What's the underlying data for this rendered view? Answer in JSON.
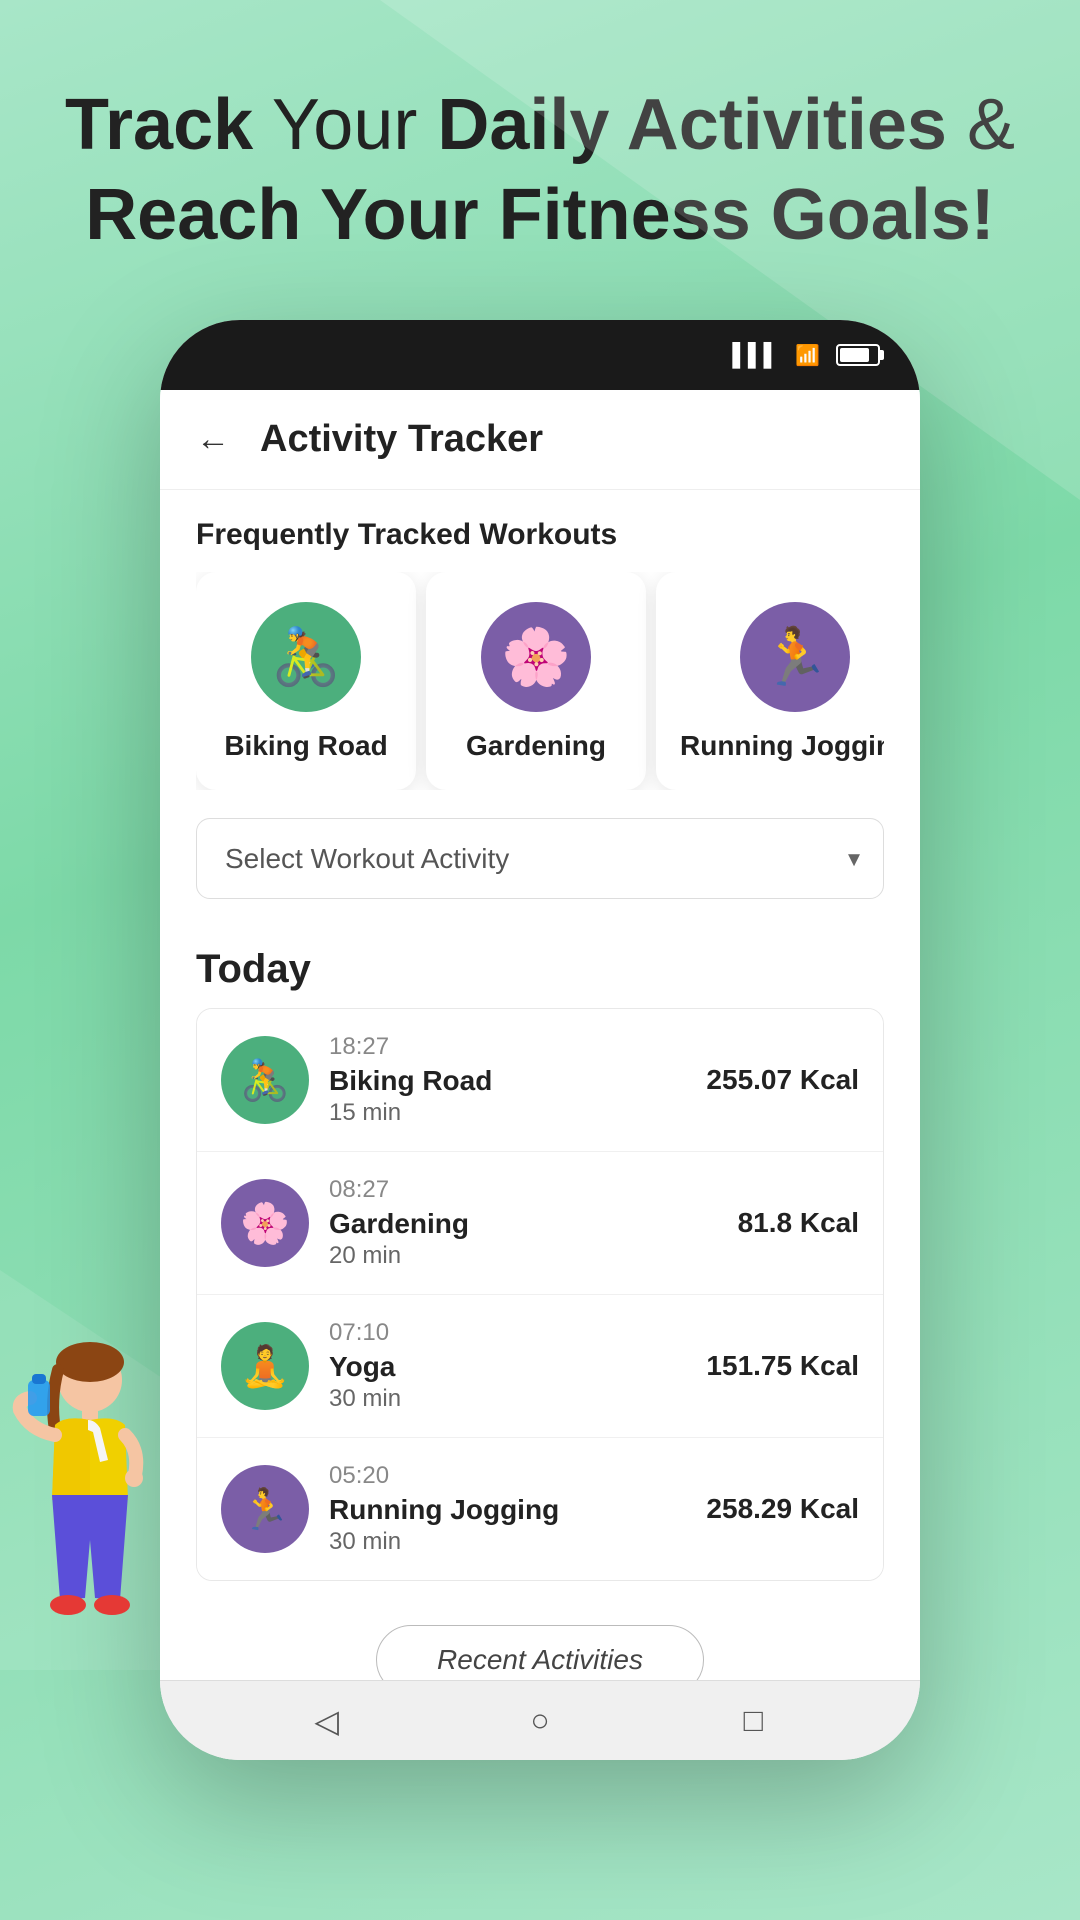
{
  "hero": {
    "line1_normal": "Track Your ",
    "line1_bold": "Daily Activities",
    "line1_normal2": " &",
    "line2": "Reach Your Fitness Goals!"
  },
  "app": {
    "title": "Activity Tracker",
    "back_label": "←"
  },
  "frequently_tracked": {
    "label": "Frequently Tracked Workouts",
    "cards": [
      {
        "name": "Biking Road",
        "icon": "🚴",
        "bg": "green"
      },
      {
        "name": "Gardening",
        "icon": "🌸",
        "bg": "purple"
      },
      {
        "name": "Running Jogging",
        "icon": "🏃",
        "bg": "purple"
      }
    ]
  },
  "dropdown": {
    "placeholder": "Select Workout Activity"
  },
  "today": {
    "label": "Today",
    "activities": [
      {
        "time": "18:27",
        "name": "Biking Road",
        "duration": "15 min",
        "kcal": "255.07 Kcal",
        "icon": "🚴",
        "bg": "green"
      },
      {
        "time": "08:27",
        "name": "Gardening",
        "duration": "20 min",
        "kcal": "81.8 Kcal",
        "icon": "🌸",
        "bg": "purple"
      },
      {
        "time": "07:10",
        "name": "Yoga",
        "duration": "30 min",
        "kcal": "151.75 Kcal",
        "icon": "🧘",
        "bg": "green2"
      },
      {
        "time": "05:20",
        "name": "Running Jogging",
        "duration": "30 min",
        "kcal": "258.29 Kcal",
        "icon": "🏃",
        "bg": "purple"
      }
    ]
  },
  "recent_btn": "Recent Activities",
  "nav": {
    "back": "◁",
    "home": "○",
    "square": "□"
  }
}
